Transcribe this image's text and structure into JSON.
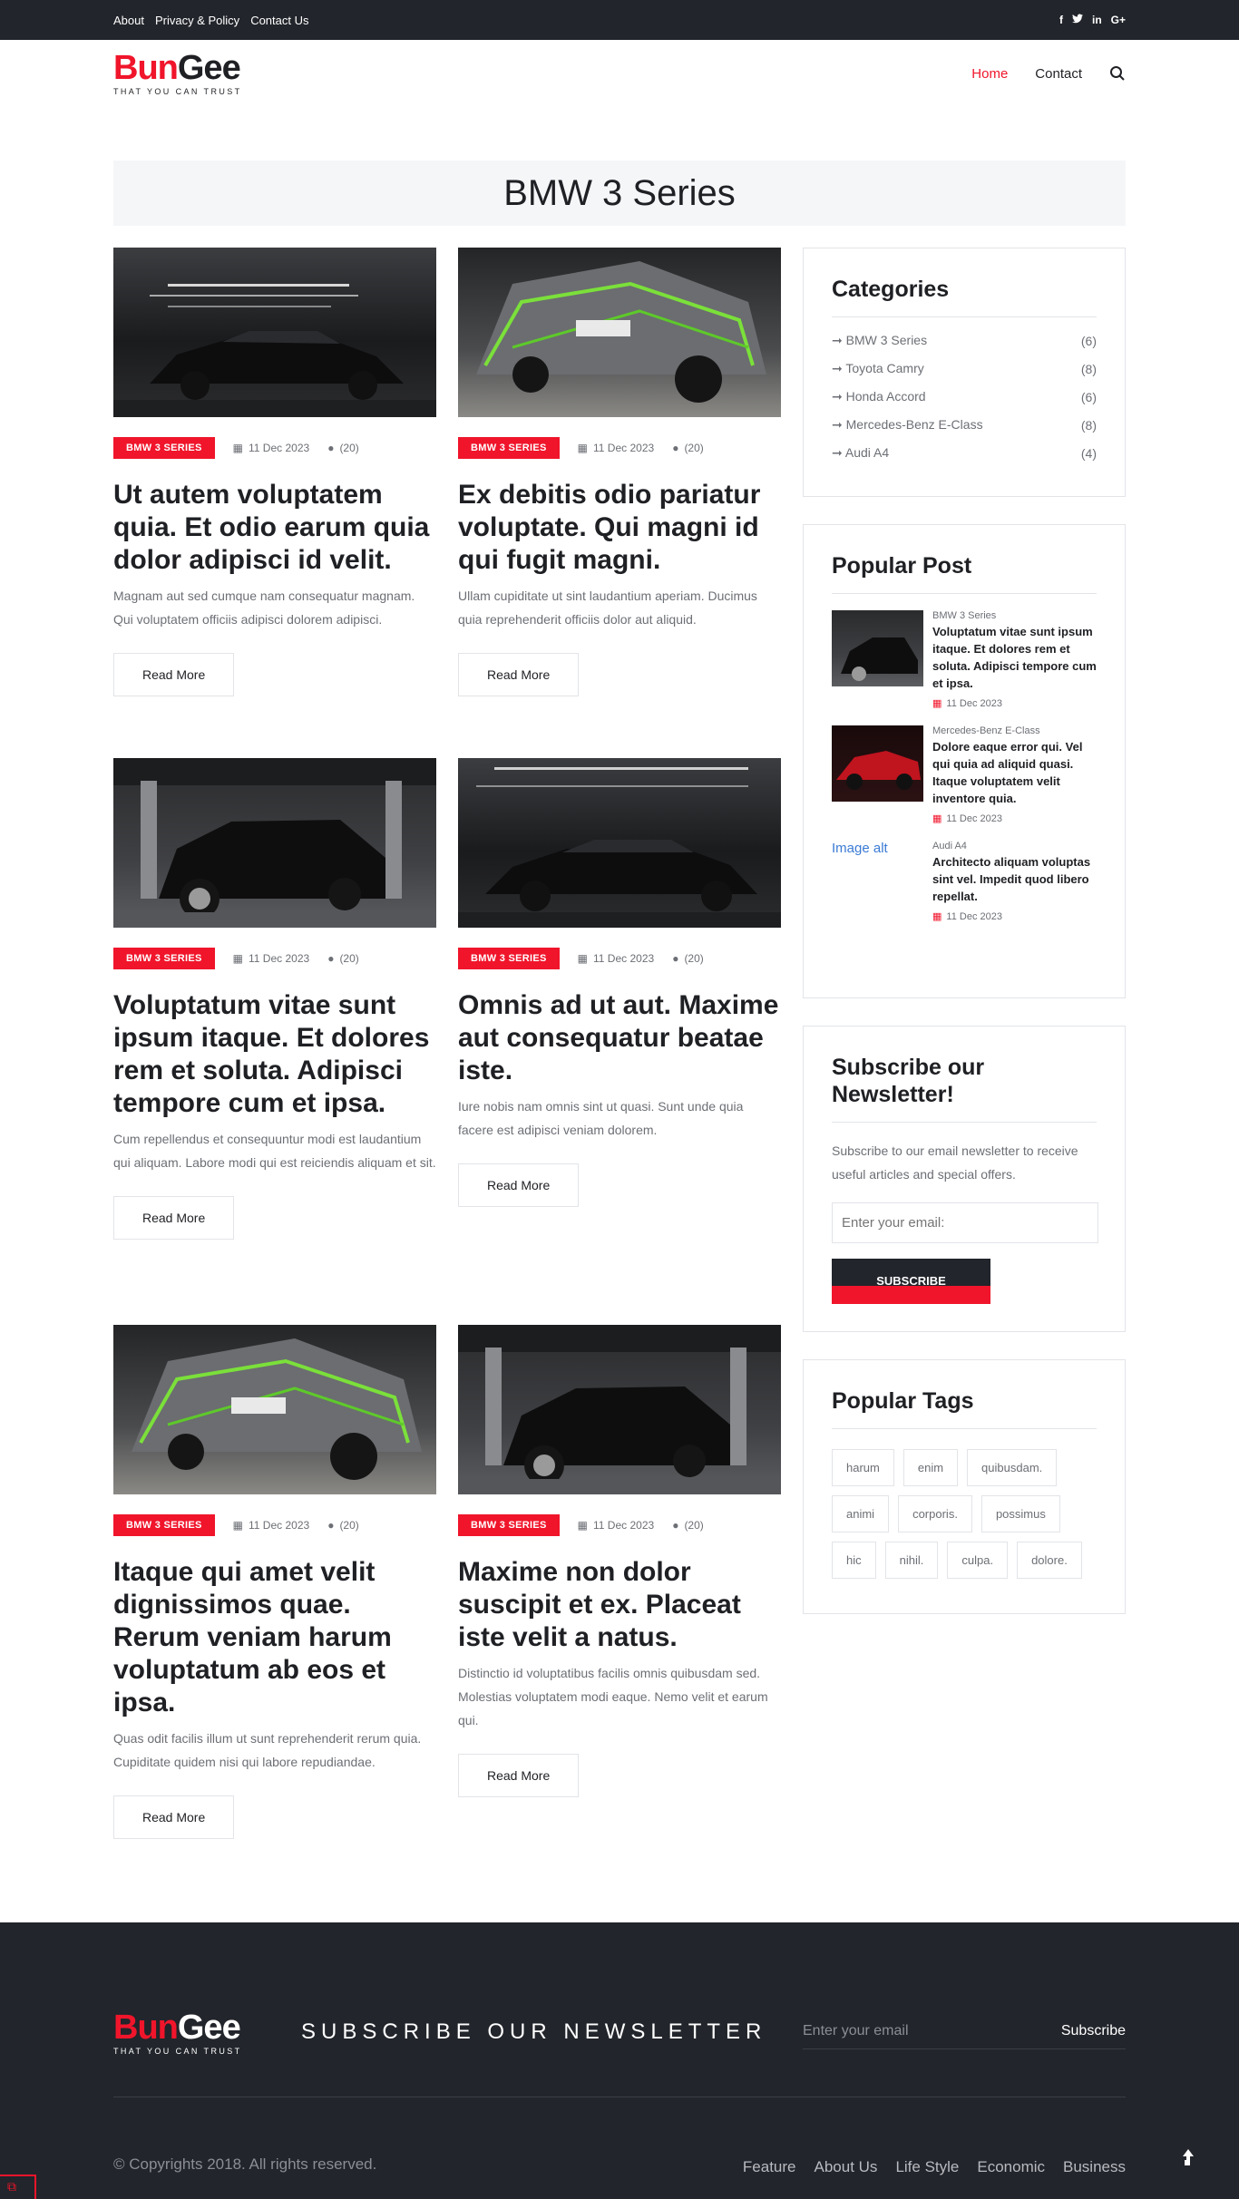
{
  "topbar": {
    "links": [
      "About",
      "Privacy & Policy",
      "Contact Us"
    ],
    "social": [
      "f",
      "t",
      "in",
      "G+"
    ]
  },
  "logo": {
    "part1": "Bun",
    "part2": "Gee",
    "tagline": "THAT YOU CAN TRUST"
  },
  "nav": {
    "home": "Home",
    "contact": "Contact",
    "search_icon": "search-icon"
  },
  "page_title": "BMW 3 Series",
  "posts": [
    {
      "category": "BMW 3 SERIES",
      "date": "11 Dec 2023",
      "comments": "(20)",
      "title": "Ut autem voluptatem quia. Et odio earum quia dolor adipisci id velit.",
      "excerpt": "Magnam aut sed cumque nam consequatur magnam. Qui voluptatem officiis adipisci dolorem adipisci.",
      "read_more": "Read More",
      "image": "black-sedan-garage"
    },
    {
      "category": "BMW 3 SERIES",
      "date": "11 Dec 2023",
      "comments": "(20)",
      "title": "Ex debitis odio pariatur voluptate. Qui magni id qui fugit magni.",
      "excerpt": "Ullam cupiditate ut sint laudantium aperiam. Ducimus quia reprehenderit officiis dolor aut aliquid.",
      "read_more": "Read More",
      "image": "race-car-green"
    },
    {
      "category": "BMW 3 SERIES",
      "date": "11 Dec 2023",
      "comments": "(20)",
      "title": "Voluptatum vitae sunt ipsum itaque. Et dolores rem et soluta. Adipisci tempore cum et ipsa.",
      "excerpt": "Cum repellendus et consequuntur modi est laudantium qui aliquam. Labore modi qui est reiciendis aliquam et sit.",
      "read_more": "Read More",
      "image": "black-hatchback-garage"
    },
    {
      "category": "BMW 3 SERIES",
      "date": "11 Dec 2023",
      "comments": "(20)",
      "title": "Omnis ad ut aut. Maxime aut consequatur beatae iste.",
      "excerpt": "Iure nobis nam omnis sint ut quasi. Sunt unde quia facere est adipisci veniam dolorem.",
      "read_more": "Read More",
      "image": "black-sedan-garage"
    },
    {
      "category": "BMW 3 SERIES",
      "date": "11 Dec 2023",
      "comments": "(20)",
      "title": "Itaque qui amet velit dignissimos quae. Rerum veniam harum voluptatum ab eos et ipsa.",
      "excerpt": "Quas odit facilis illum ut sunt reprehenderit rerum quia. Cupiditate quidem nisi qui labore repudiandae.",
      "read_more": "Read More",
      "image": "race-car-green"
    },
    {
      "category": "BMW 3 SERIES",
      "date": "11 Dec 2023",
      "comments": "(20)",
      "title": "Maxime non dolor suscipit et ex. Placeat iste velit a natus.",
      "excerpt": "Distinctio id voluptatibus facilis omnis quibusdam sed. Molestias voluptatem modi eaque. Nemo velit et earum qui.",
      "read_more": "Read More",
      "image": "black-hatchback-garage"
    }
  ],
  "sidebar": {
    "categories": {
      "title": "Categories",
      "items": [
        {
          "label": "BMW 3 Series",
          "count": "(6)"
        },
        {
          "label": "Toyota Camry",
          "count": "(8)"
        },
        {
          "label": "Honda Accord",
          "count": "(6)"
        },
        {
          "label": "Mercedes-Benz E-Class",
          "count": "(8)"
        },
        {
          "label": "Audi A4",
          "count": "(4)"
        }
      ]
    },
    "popular_post": {
      "title": "Popular Post",
      "items": [
        {
          "category": "BMW 3 Series",
          "title": "Voluptatum vitae sunt ipsum itaque. Et dolores rem et soluta. Adipisci tempore cum et ipsa.",
          "date": "11 Dec 2023",
          "image": "black-hatchback-garage"
        },
        {
          "category": "Mercedes-Benz E-Class",
          "title": "Dolore eaque error qui. Vel qui quia ad aliquid quasi. Itaque voluptatem velit inventore quia.",
          "date": "11 Dec 2023",
          "image": "red-car"
        },
        {
          "category": "Audi A4",
          "title": "Architecto aliquam voluptas sint vel. Impedit quod libero repellat.",
          "date": "11 Dec 2023",
          "alt": "Image alt"
        }
      ]
    },
    "newsletter": {
      "title": "Subscribe our Newsletter!",
      "text": "Subscribe to our email newsletter to receive useful articles and special offers.",
      "placeholder": "Enter your email:",
      "button": "SUBSCRIBE"
    },
    "tags": {
      "title": "Popular Tags",
      "items": [
        "harum",
        "enim",
        "quibusdam.",
        "animi",
        "corporis.",
        "possimus",
        "hic",
        "nihil.",
        "culpa.",
        "dolore."
      ]
    }
  },
  "footer": {
    "subscribe_title": "SUBSCRIBE OUR NEWSLETTER",
    "email_placeholder": "Enter your email",
    "subscribe_button": "Subscribe",
    "copyright": "© Copyrights 2018. All rights reserved.",
    "links": [
      "Feature",
      "About Us",
      "Life Style",
      "Economic",
      "Business"
    ]
  },
  "colors": {
    "accent": "#f0152b",
    "dark": "#22252b",
    "text": "#1f2024",
    "muted": "#6c6f75",
    "border": "#e2e4e8"
  }
}
